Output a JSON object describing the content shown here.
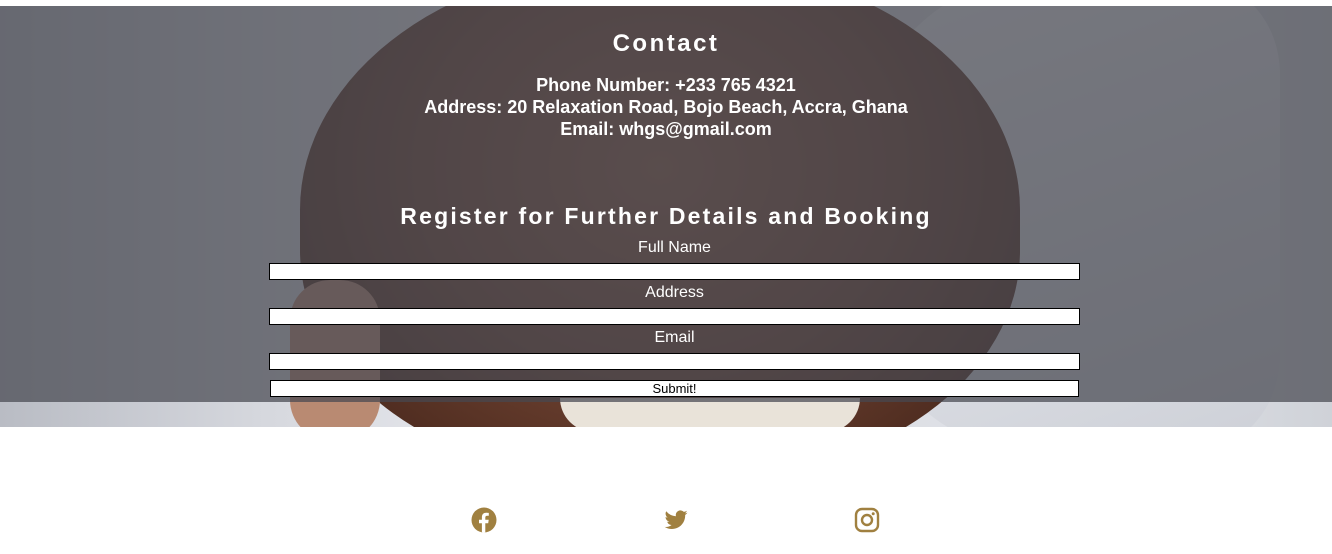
{
  "contact": {
    "title": "Contact",
    "phone": "Phone Number: +233 765 4321",
    "address": "Address: 20 Relaxation Road, Bojo Beach, Accra, Ghana",
    "email": "Email: whgs@gmail.com"
  },
  "register": {
    "title": "Register for Further Details and Booking",
    "fields": {
      "full_name": {
        "label": "Full Name",
        "value": ""
      },
      "address": {
        "label": "Address",
        "value": ""
      },
      "email": {
        "label": "Email",
        "value": ""
      }
    },
    "submit_label": "Submit!"
  },
  "social": {
    "icons": [
      "facebook-icon",
      "twitter-icon",
      "instagram-icon"
    ],
    "icon_color": "#a08040"
  },
  "colors": {
    "overlay": "#464850",
    "text": "#ffffff",
    "accent": "#a08040"
  }
}
